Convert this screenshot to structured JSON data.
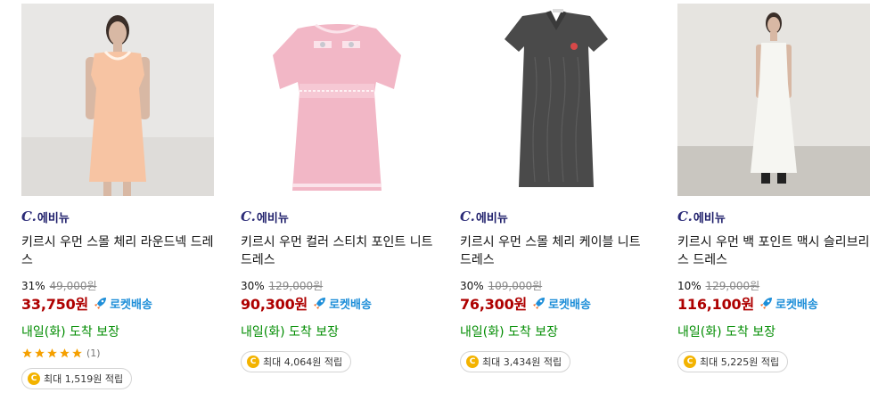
{
  "products": [
    {
      "brand": "에비뉴",
      "brand_mark": "C.",
      "name": "키르시 우먼 스몰 체리 라운드넥 드레스",
      "discount": "31%",
      "original_price": "49,000원",
      "price": "33,750원",
      "delivery_badge": "로켓배송",
      "arrival": "내일(화) 도착 보장",
      "rating_stars": 5,
      "review_count": "(1)",
      "reward": "최대 1,519원 적립"
    },
    {
      "brand": "에비뉴",
      "brand_mark": "C.",
      "name": "키르시 우먼 컬러 스티치 포인트 니트 드레스",
      "discount": "30%",
      "original_price": "129,000원",
      "price": "90,300원",
      "delivery_badge": "로켓배송",
      "arrival": "내일(화) 도착 보장",
      "reward": "최대 4,064원 적립"
    },
    {
      "brand": "에비뉴",
      "brand_mark": "C.",
      "name": "키르시 우먼 스몰 체리 케이블 니트 드레스",
      "discount": "30%",
      "original_price": "109,000원",
      "price": "76,300원",
      "delivery_badge": "로켓배송",
      "arrival": "내일(화) 도착 보장",
      "reward": "최대 3,434원 적립"
    },
    {
      "brand": "에비뉴",
      "brand_mark": "C.",
      "name": "키르시 우먼 백 포인트 맥시 슬리브리스 드레스",
      "discount": "10%",
      "original_price": "129,000원",
      "price": "116,100원",
      "delivery_badge": "로켓배송",
      "arrival": "내일(화) 도착 보장",
      "reward": "최대 5,225원 적립"
    }
  ],
  "colors": {
    "price": "#ae0000",
    "arrival": "#008c00",
    "rocket": "#1d8ed8",
    "brand": "#1f1f6b",
    "star": "#f5a000",
    "coin": "#f3b300"
  },
  "icons": {
    "rocket": "rocket-icon",
    "star": "star-icon",
    "coin": "coin-icon"
  }
}
